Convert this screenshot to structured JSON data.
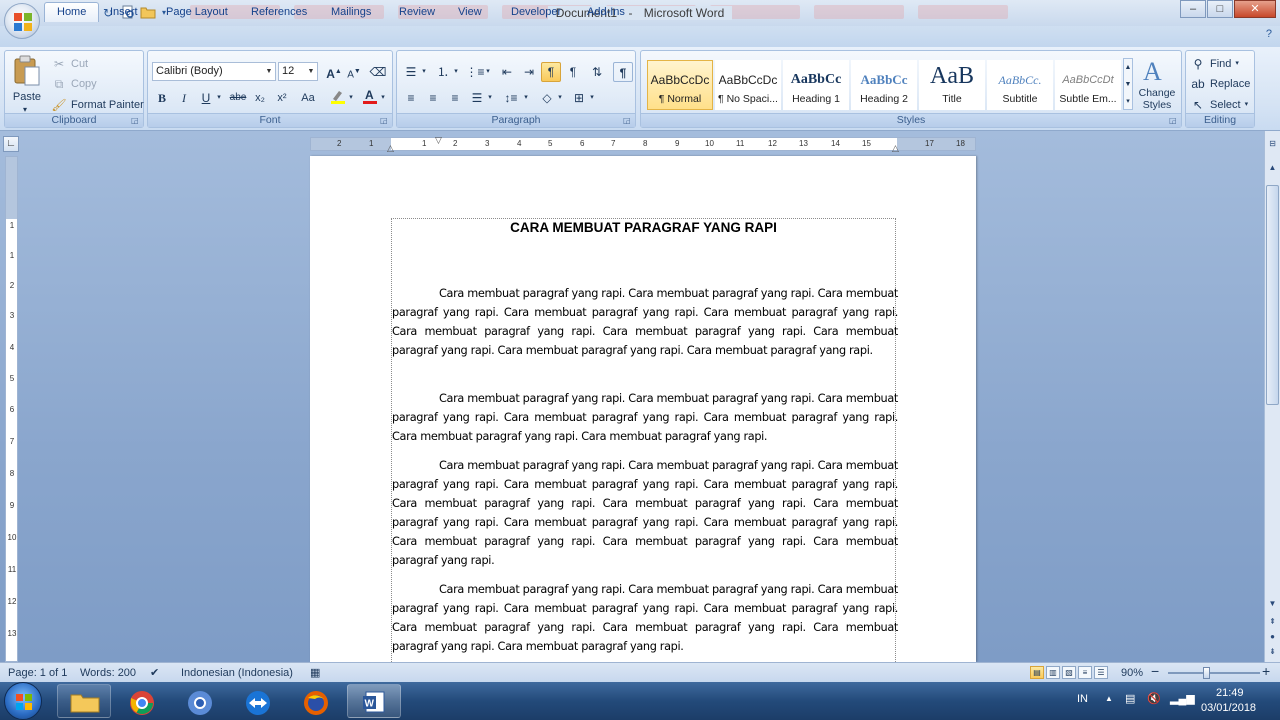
{
  "window": {
    "title_doc": "Document1",
    "title_sep": " - ",
    "title_app": "Microsoft Word",
    "controls": {
      "minimize": "–",
      "maximize": "□",
      "close": "✕"
    }
  },
  "ribbon_tabs": [
    "Home",
    "Insert",
    "Page Layout",
    "References",
    "Mailings",
    "Review",
    "View",
    "Developer",
    "Add-Ins"
  ],
  "clipboard": {
    "paste": "Paste",
    "cut": "Cut",
    "copy": "Copy",
    "format_painter": "Format Painter",
    "label": "Clipboard"
  },
  "font": {
    "family": "Calibri (Body)",
    "size": "12",
    "label": "Font",
    "bold": "B",
    "italic": "I",
    "underline": "U",
    "strike": "abe",
    "subscript": "x₂",
    "superscript": "x²",
    "change_case": "Aa",
    "grow": "A",
    "shrink": "A"
  },
  "paragraph": {
    "label": "Paragraph"
  },
  "styles": {
    "label": "Styles",
    "items": [
      {
        "sample": "AaBbCcDc",
        "name": "¶ Normal"
      },
      {
        "sample": "AaBbCcDc",
        "name": "¶ No Spaci..."
      },
      {
        "sample": "AaBbCc",
        "name": "Heading 1"
      },
      {
        "sample": "AaBbCc",
        "name": "Heading 2"
      },
      {
        "sample": "AaB",
        "name": "Title"
      },
      {
        "sample": "AaBbCc.",
        "name": "Subtitle"
      },
      {
        "sample": "AaBbCcDt",
        "name": "Subtle Em..."
      }
    ],
    "change_styles": "Change Styles"
  },
  "editing": {
    "label": "Editing",
    "find": "Find",
    "replace": "Replace",
    "select": "Select"
  },
  "ruler": {
    "h_numbers": [
      "2",
      "1",
      "1",
      "2",
      "3",
      "4",
      "5",
      "6",
      "7",
      "8",
      "9",
      "10",
      "11",
      "12",
      "13",
      "14",
      "15",
      "17",
      "18"
    ],
    "v_numbers": [
      "1",
      "1",
      "2",
      "3",
      "4",
      "5",
      "6",
      "7",
      "8",
      "9",
      "10",
      "11",
      "12",
      "13"
    ]
  },
  "document": {
    "title": "CARA MEMBUAT PARAGRAF YANG RAPI",
    "paragraphs": [
      "Cara membuat paragraf yang rapi. Cara membuat paragraf yang rapi. Cara membuat paragraf yang rapi. Cara membuat paragraf yang rapi. Cara membuat paragraf yang rapi. Cara membuat paragraf yang rapi. Cara membuat paragraf yang rapi. Cara membuat paragraf yang rapi. Cara membuat paragraf yang rapi. Cara membuat paragraf yang rapi.",
      "Cara membuat paragraf yang rapi. Cara membuat paragraf yang rapi. Cara membuat paragraf yang rapi. Cara membuat paragraf yang rapi. Cara membuat paragraf yang rapi. Cara membuat paragraf yang rapi. Cara membuat paragraf yang rapi.",
      "Cara membuat paragraf yang rapi. Cara membuat paragraf yang rapi. Cara membuat paragraf yang rapi. Cara membuat paragraf yang rapi. Cara membuat paragraf yang rapi. Cara membuat paragraf yang rapi. Cara membuat paragraf yang rapi. Cara membuat paragraf yang rapi. Cara membuat paragraf yang rapi. Cara membuat paragraf yang rapi. Cara membuat paragraf yang rapi. Cara membuat paragraf yang rapi. Cara membuat paragraf yang rapi.",
      "Cara membuat paragraf yang rapi. Cara membuat paragraf yang rapi. Cara membuat paragraf yang rapi. Cara membuat paragraf yang rapi. Cara membuat paragraf yang rapi. Cara membuat paragraf yang rapi. Cara membuat paragraf yang rapi. Cara membuat paragraf yang rapi. Cara membuat paragraf yang rapi."
    ]
  },
  "status": {
    "page": "Page: 1 of 1",
    "words": "Words: 200",
    "language": "Indonesian (Indonesia)",
    "zoom": "90%",
    "zoom_minus": "−",
    "zoom_plus": "+"
  },
  "taskbar": {
    "lang": "IN",
    "time": "21:49",
    "date": "03/01/2018",
    "show_hidden": "▲"
  },
  "colors": {
    "accent": "#15428b",
    "ribbon": "#d5e3f4",
    "workspace": "#8aa6cd",
    "selected_style": "#ffe08a"
  }
}
